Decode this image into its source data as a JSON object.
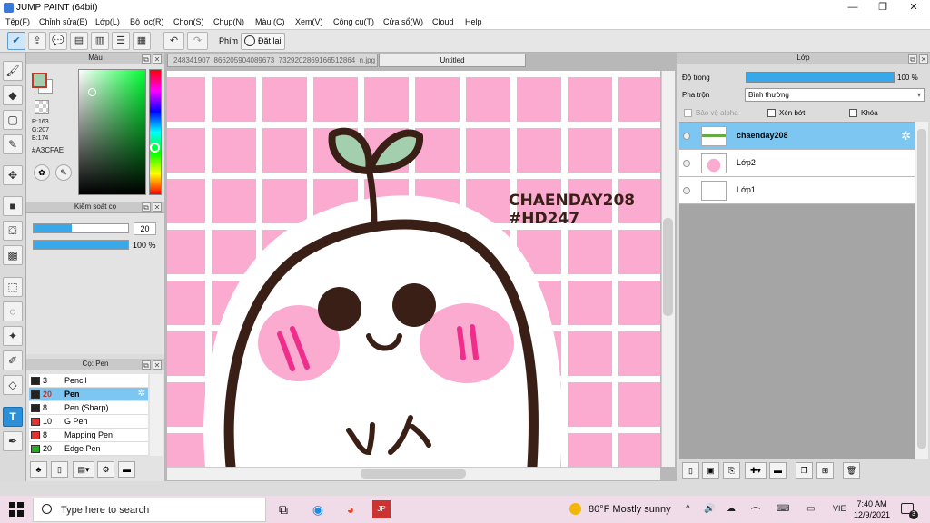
{
  "title": "JUMP PAINT (64bit)",
  "menu": [
    "Tệp(F)",
    "Chỉnh sửa(E)",
    "Lớp(L)",
    "Bộ lọc(R)",
    "Chọn(S)",
    "Chụp(N)",
    "Màu (C)",
    "Xem(V)",
    "Công cụ(T)",
    "Cửa sổ(W)",
    "Cloud",
    "Help"
  ],
  "toolbar": {
    "phim_label": "Phím",
    "reset_label": "Đặt lại"
  },
  "color_panel": {
    "title": "Màu",
    "r": "R:163",
    "g": "G:207",
    "b": "B:174",
    "hex": "#A3CFAE",
    "primary": "#a3cfae"
  },
  "brush_control": {
    "title": "Kiểm soát cọ",
    "size": "20",
    "opacity": "100 %"
  },
  "brush_panel": {
    "title": "Cọ: Pen",
    "items": [
      {
        "num": "3",
        "name": "Pencil",
        "color": "#222222"
      },
      {
        "num": "20",
        "name": "Pen",
        "color": "#222222"
      },
      {
        "num": "8",
        "name": "Pen (Sharp)",
        "color": "#222222"
      },
      {
        "num": "10",
        "name": "G Pen",
        "color": "#e03030"
      },
      {
        "num": "8",
        "name": "Mapping Pen",
        "color": "#e03030"
      },
      {
        "num": "20",
        "name": "Edge Pen",
        "color": "#22aa22"
      }
    ]
  },
  "documents": {
    "tab1": "248341907_866205904089673_7329202869166512864_n.jpg",
    "tab2": "Untitled"
  },
  "artwork": {
    "text1": "CHAENDAY208",
    "text2": "#HD247"
  },
  "layer_panel": {
    "title": "Lớp",
    "opacity_label": "Độ trong",
    "opacity_value": "100 %",
    "blend_label": "Pha trộn",
    "blend_value": "Bình thường",
    "protect_alpha": "Bảo vệ alpha",
    "clipping": "Xén bớt",
    "lock": "Khóa",
    "layers": [
      "chaenday208",
      "Lớp2",
      "Lớp1"
    ]
  },
  "taskbar": {
    "search_placeholder": "Type here to search",
    "weather": "80°F  Mostly sunny",
    "lang": "VIE",
    "time": "7:40 AM",
    "date": "12/9/2021",
    "notifications": "3"
  }
}
